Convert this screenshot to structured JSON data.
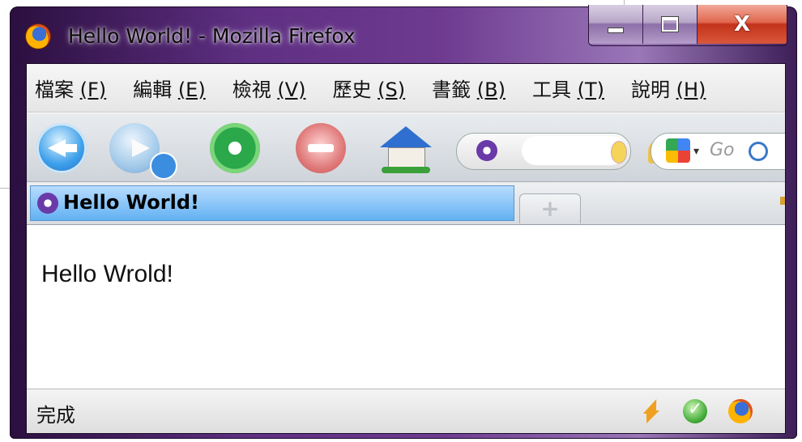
{
  "window": {
    "title": "Hello World! - Mozilla Firefox",
    "close_glyph": "X"
  },
  "menubar": {
    "items": [
      {
        "label": "檔案 ",
        "accel": "(F)"
      },
      {
        "label": "編輯 ",
        "accel": "(E)"
      },
      {
        "label": "檢視 ",
        "accel": "(V)"
      },
      {
        "label": "歷史 ",
        "accel": "(S)"
      },
      {
        "label": "書籤 ",
        "accel": "(B)"
      },
      {
        "label": "工具 ",
        "accel": "(T)"
      },
      {
        "label": "說明 ",
        "accel": "(H)"
      }
    ]
  },
  "toolbar": {
    "search_placeholder": "Go"
  },
  "tabs": {
    "active_label": "Hello World!",
    "new_tab_glyph": "+"
  },
  "content": {
    "text": "Hello Wrold!"
  },
  "statusbar": {
    "text": "完成"
  },
  "icons": {
    "app": "firefox-icon",
    "back": "back-icon",
    "forward": "forward-icon",
    "reload": "reload-icon",
    "stop": "stop-icon",
    "home": "home-icon",
    "search_engine": "google-icon"
  }
}
